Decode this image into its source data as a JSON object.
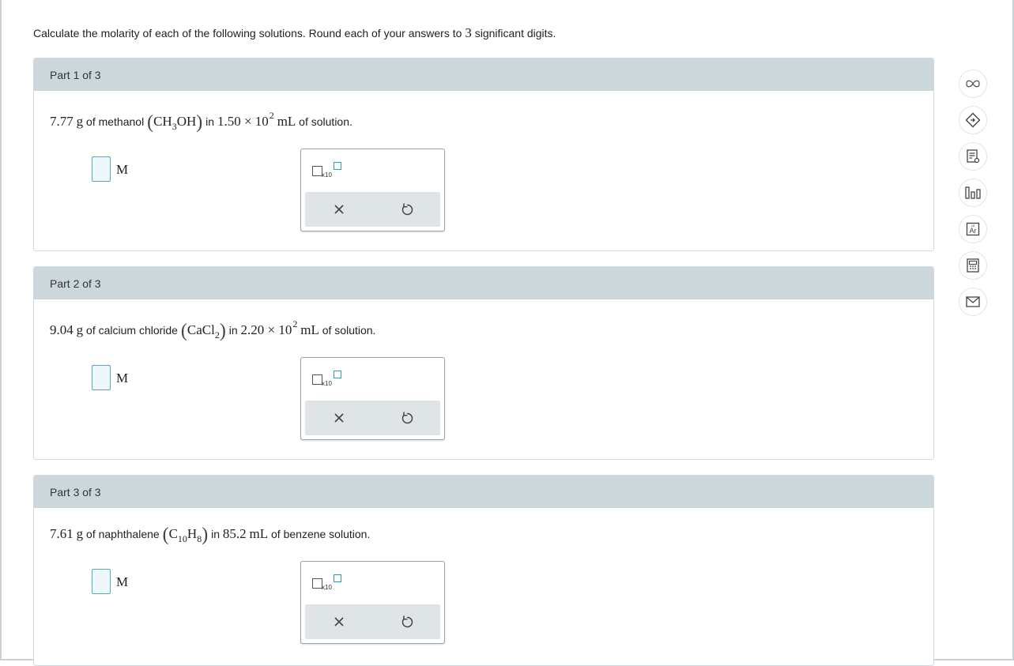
{
  "instructions": {
    "text_before": "Calculate the molarity of each of the following solutions. Round each of your answers to ",
    "sig_figs": "3",
    "text_after": " significant digits."
  },
  "parts": [
    {
      "header": "Part 1 of 3",
      "mass": "7.77",
      "mass_unit": "g",
      "text_of": " of methanol ",
      "formula_a": "CH",
      "formula_sub_a": "3",
      "formula_b": "OH",
      "formula_sub_b": "",
      "text_in": " in ",
      "volume": "1.50 × 10",
      "volume_exp": "2",
      "volume_unit": "mL",
      "text_end": " of solution.",
      "unit_label": "M"
    },
    {
      "header": "Part 2 of 3",
      "mass": "9.04",
      "mass_unit": "g",
      "text_of": " of calcium chloride ",
      "formula_a": "CaCl",
      "formula_sub_a": "2",
      "formula_b": "",
      "formula_sub_b": "",
      "text_in": " in ",
      "volume": "2.20 × 10",
      "volume_exp": "2",
      "volume_unit": "mL",
      "text_end": " of solution.",
      "unit_label": "M"
    },
    {
      "header": "Part 3 of 3",
      "mass": "7.61",
      "mass_unit": "g",
      "text_of": " of naphthalene ",
      "formula_a": "C",
      "formula_sub_a": "10",
      "formula_b": "H",
      "formula_sub_b": "8",
      "text_in": " in ",
      "volume": "85.2",
      "volume_exp": "",
      "volume_unit": "mL",
      "text_end": " of benzene solution.",
      "unit_label": "M"
    }
  ],
  "toolpanel": {
    "x10_label": "x10"
  },
  "side_tools": [
    "infinity-icon",
    "explanation-icon",
    "worksheet-icon",
    "data-chart-icon",
    "periodic-table-icon",
    "calculator-icon",
    "email-icon"
  ],
  "colors": {
    "header_bg": "#ccd7dc",
    "input_border": "#5aa9b8",
    "accent": "#2aa0b8"
  }
}
